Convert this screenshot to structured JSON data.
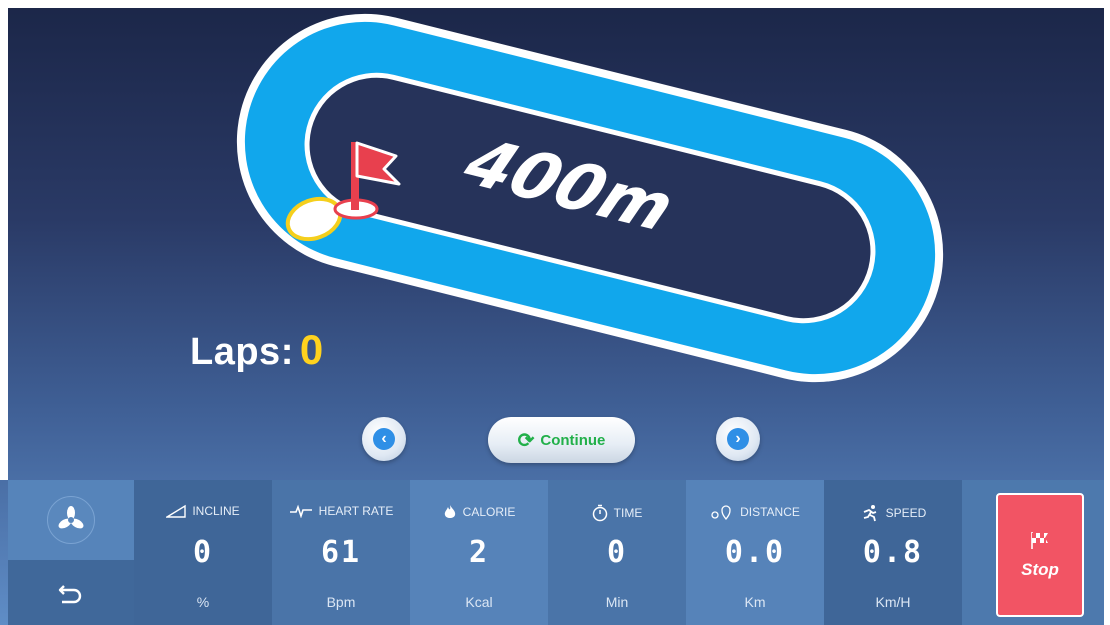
{
  "track": {
    "distance_label": "400m"
  },
  "laps": {
    "label": "Laps:",
    "value": "0"
  },
  "controls": {
    "prev_icon": "chevron-left-icon",
    "next_icon": "chevron-right-icon",
    "continue_label": "Continue",
    "continue_icon": "refresh-icon"
  },
  "side": {
    "fan_icon": "fan-icon",
    "back_icon": "back-arrow-icon"
  },
  "metrics": [
    {
      "label": "INCLINE",
      "value": "0",
      "unit": "%",
      "icon": "incline-icon"
    },
    {
      "label": "HEART RATE",
      "value": "61",
      "unit": "Bpm",
      "icon": "heartbeat-icon"
    },
    {
      "label": "CALORIE",
      "value": "2",
      "unit": "Kcal",
      "icon": "flame-icon"
    },
    {
      "label": "TIME",
      "value": "0",
      "unit": "Min",
      "icon": "stopwatch-icon"
    },
    {
      "label": "DISTANCE",
      "value": "0.0",
      "unit": "Km",
      "icon": "location-pin-icon"
    },
    {
      "label": "SPEED",
      "value": "0.8",
      "unit": "Km/H",
      "icon": "runner-icon"
    }
  ],
  "stop": {
    "label": "Stop",
    "icon": "checkered-flag-icon"
  },
  "colors": {
    "track": "#11a7ec",
    "laps_value": "#ffd21e",
    "continue_text": "#22b04a",
    "stop_bg": "#f25464"
  }
}
